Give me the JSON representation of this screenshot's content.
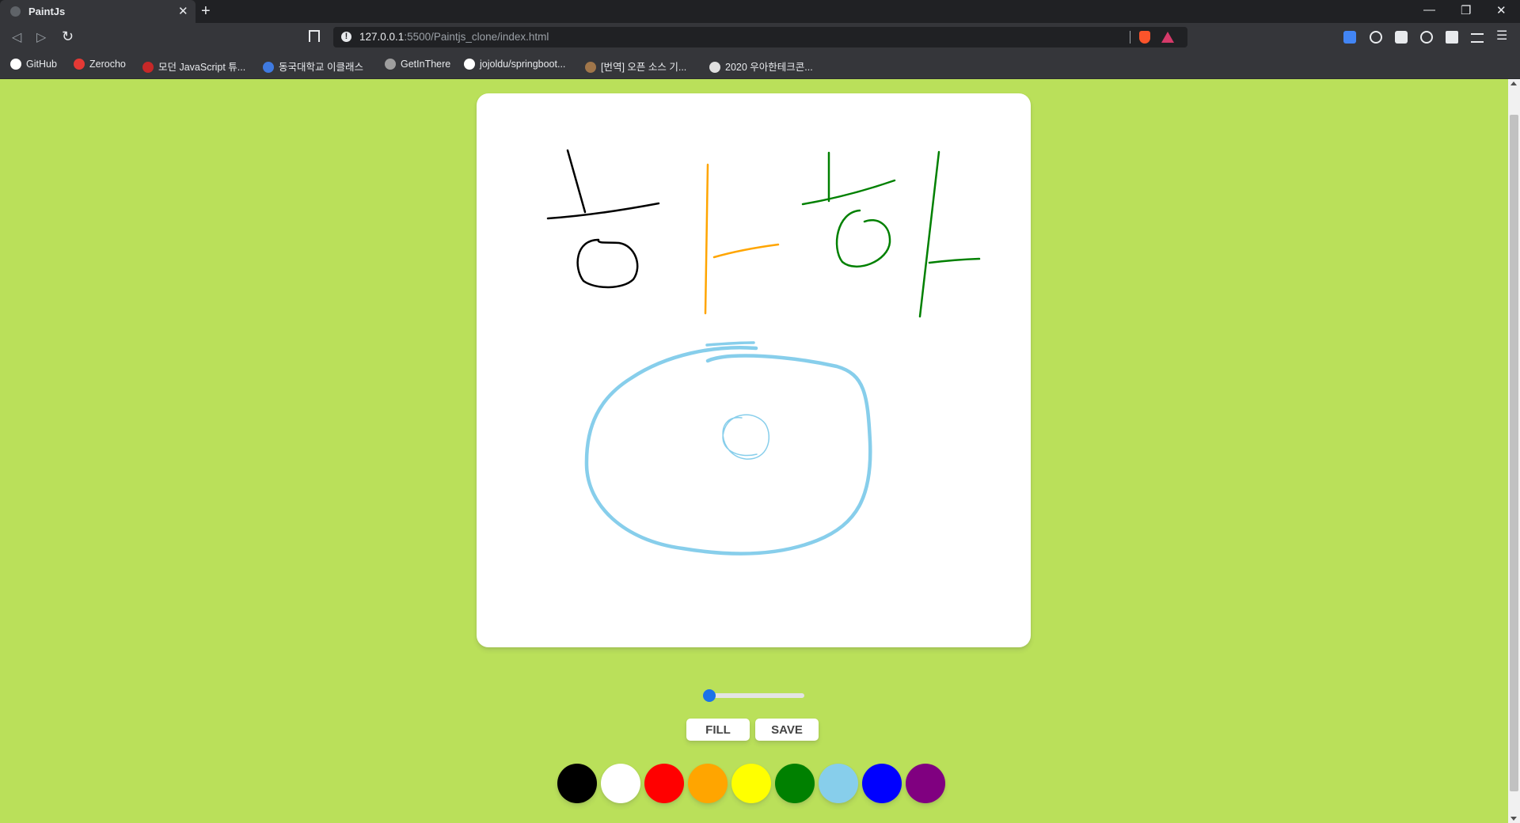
{
  "browser": {
    "tab_title": "PaintJs",
    "new_tab": "+",
    "close_tab": "✕",
    "window_controls": [
      "—",
      "❐",
      "✕"
    ],
    "url_host": "127.0.0.1",
    "url_rest": ":5500/Paintjs_clone/index.html"
  },
  "bookmarks": [
    {
      "label": "GitHub",
      "icon_color": "#ffffff"
    },
    {
      "label": "Zerocho",
      "icon_color": "#e53935"
    },
    {
      "label": "모던 JavaScript 튜...",
      "icon_color": "#c62828"
    },
    {
      "label": "동국대학교 이클래스",
      "icon_color": "#3f7ae0"
    },
    {
      "label": "GetInThere",
      "icon_color": "#9e9e9e"
    },
    {
      "label": "jojoldu/springboot...",
      "icon_color": "#ffffff"
    },
    {
      "label": "[번역] 오픈 소스 기...",
      "icon_color": "#a0764a"
    },
    {
      "label": "2020 우아한테크콘...",
      "icon_color": "#e0e0e0"
    }
  ],
  "controls": {
    "range": {
      "min": 0.1,
      "max": 5,
      "value": 0.1
    },
    "fill_label": "FILL",
    "save_label": "SAVE"
  },
  "palette": [
    "#000000",
    "#ffffff",
    "#ff0000",
    "#ffa500",
    "#ffff00",
    "#008000",
    "#87ceeb",
    "#0000ff",
    "#800080"
  ],
  "colors": {
    "page_background": "#bae05a",
    "canvas_background": "#ffffff",
    "accent": "#1a73e8"
  }
}
